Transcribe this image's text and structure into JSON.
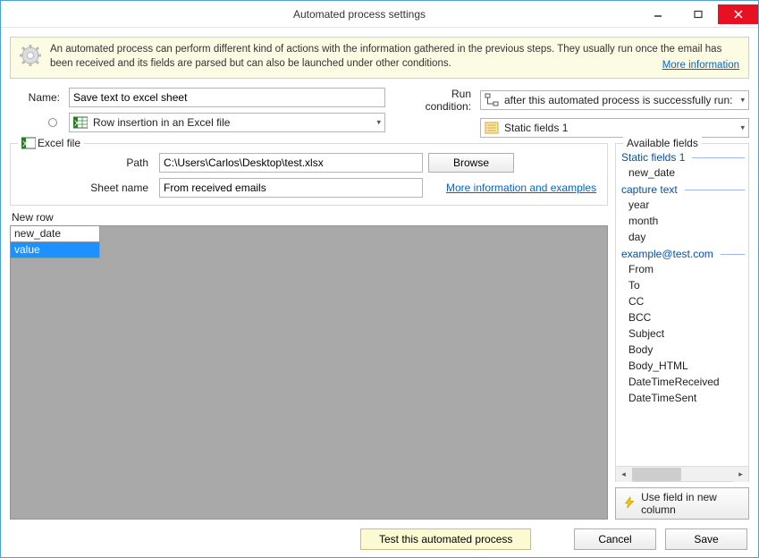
{
  "window": {
    "title": "Automated process settings"
  },
  "banner": {
    "text": "An automated process can perform different kind of actions with the information gathered in the previous steps. They usually run once the email has been received and its fields are parsed but can also be launched under other conditions.",
    "link": "More information"
  },
  "labels": {
    "name": "Name:",
    "run_condition": "Run condition:"
  },
  "name_value": "Save text to excel sheet",
  "type_select": "Row insertion in an Excel file",
  "run_condition_select": "after this automated process is successfully run:",
  "source_select": "Static fields 1",
  "excel_group": {
    "legend": "Excel file",
    "path_label": "Path",
    "path_value": "C:\\Users\\Carlos\\Desktop\\test.xlsx",
    "browse": "Browse",
    "sheet_label": "Sheet name",
    "sheet_value": "From received emails",
    "link": "More information and examples"
  },
  "newrow": {
    "legend": "New row",
    "header": "new_date",
    "selected": "value"
  },
  "available": {
    "legend": "Available fields",
    "groups": [
      {
        "name": "Static fields 1",
        "items": [
          "new_date"
        ]
      },
      {
        "name": "capture text",
        "items": [
          "year",
          "month",
          "day"
        ]
      },
      {
        "name": "example@test.com",
        "items": [
          "From",
          "To",
          "CC",
          "BCC",
          "Subject",
          "Body",
          "Body_HTML",
          "DateTimeReceived",
          "DateTimeSent"
        ]
      }
    ],
    "use_button": "Use field in new column"
  },
  "footer": {
    "test": "Test this automated process",
    "cancel": "Cancel",
    "save": "Save"
  }
}
